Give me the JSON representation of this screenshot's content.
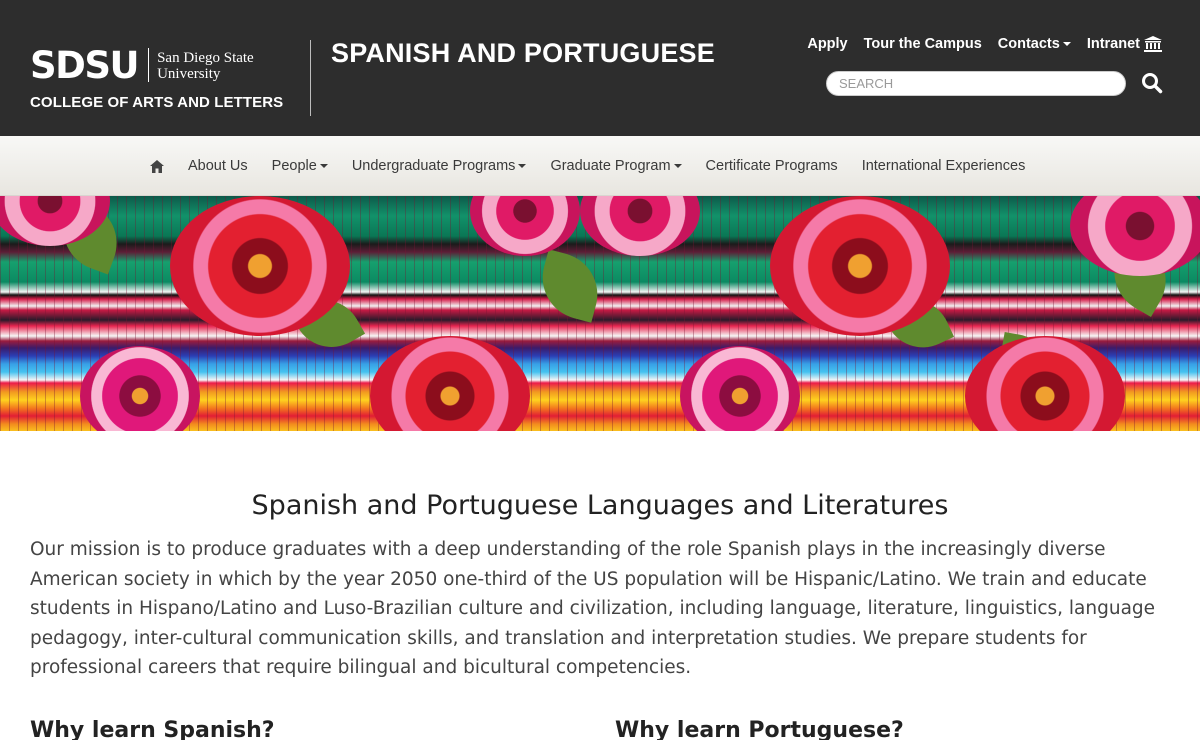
{
  "header": {
    "logo_mark": "SDSU",
    "logo_university_line1": "San Diego State",
    "logo_university_line2": "University",
    "college": "COLLEGE OF ARTS AND LETTERS",
    "department": "SPANISH AND PORTUGUESE",
    "utility_links": {
      "apply": "Apply",
      "tour": "Tour the Campus",
      "contacts": "Contacts",
      "intranet": "Intranet"
    },
    "search": {
      "placeholder": "SEARCH",
      "value": ""
    },
    "icons": {
      "search": "search-icon",
      "intranet": "bank-icon",
      "home": "home-icon"
    }
  },
  "nav": {
    "items": [
      {
        "label": "About Us",
        "dropdown": false
      },
      {
        "label": "People",
        "dropdown": true
      },
      {
        "label": "Undergraduate Programs",
        "dropdown": true
      },
      {
        "label": "Graduate Program",
        "dropdown": true
      },
      {
        "label": "Certificate Programs",
        "dropdown": false
      },
      {
        "label": "International Experiences",
        "dropdown": false
      }
    ]
  },
  "main": {
    "title": "Spanish and Portuguese Languages and Literatures",
    "mission": "Our mission is to produce graduates with a deep understanding of the role Spanish plays in the increasingly diverse American society in which by the year 2050 one-third of the US population will be Hispanic/Latino. We train and educate students in Hispano/Latino and Luso-Brazilian culture and civilization, including language, literature, linguistics, language pedagogy, inter-cultural communication skills, and translation and interpretation studies. We prepare students for professional careers that require bilingual and bicultural competencies.",
    "why_spanish": "Why learn Spanish?",
    "why_portuguese": "Why learn Portuguese?"
  },
  "colors": {
    "header_bg": "#2d2d2d",
    "nav_bg": "#efeeea",
    "text": "#444444"
  }
}
